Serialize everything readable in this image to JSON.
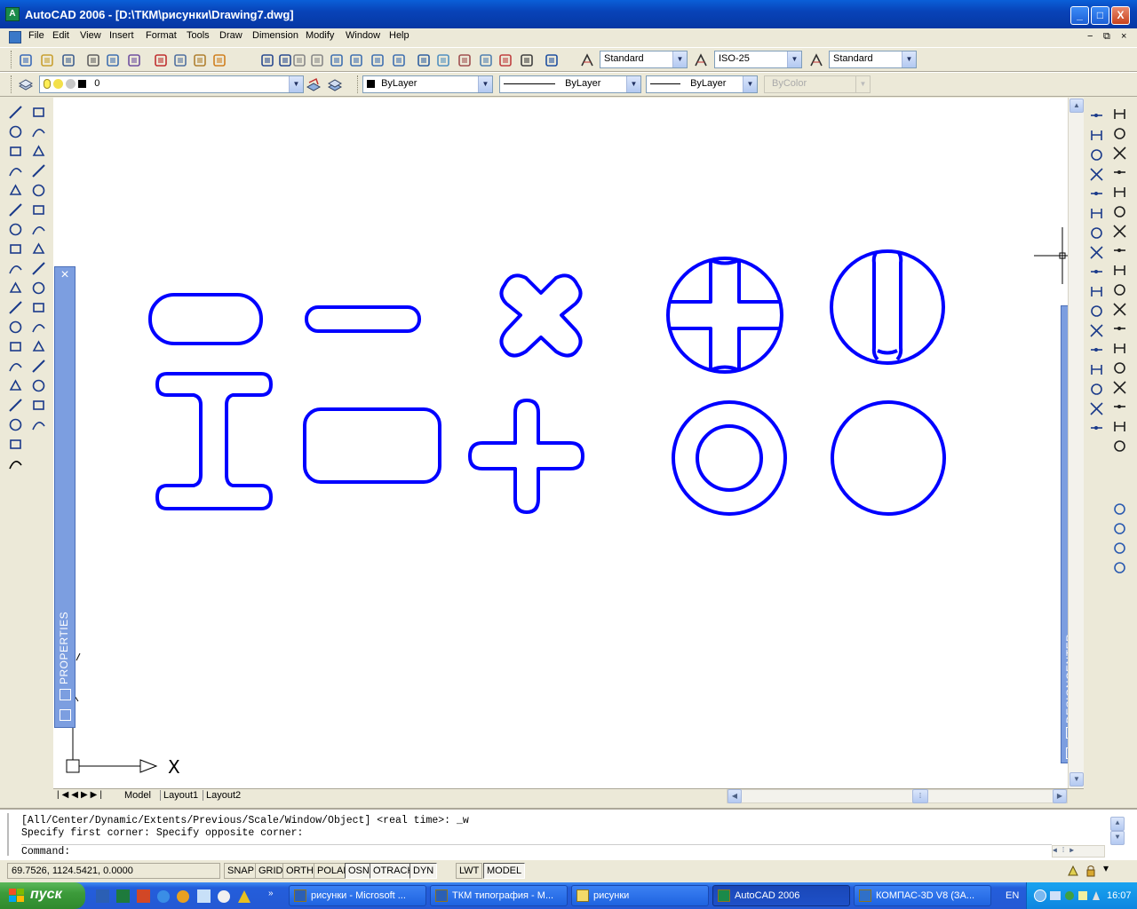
{
  "window": {
    "title": "AutoCAD 2006 - [D:\\ТКМ\\рисунки\\Drawing7.dwg]",
    "app_icon": "autocad-icon",
    "buttons": {
      "minimize": "_",
      "maximize": "□",
      "close": "X"
    }
  },
  "menu": {
    "items": [
      "File",
      "Edit",
      "View",
      "Insert",
      "Format",
      "Tools",
      "Draw",
      "Dimension",
      "Modify",
      "Window",
      "Help"
    ],
    "doc_controls": {
      "minimize": "−",
      "restore": "⧉",
      "close": "×"
    }
  },
  "toolbars": {
    "standard": {
      "text_style": "Standard",
      "dim_style": "ISO-25",
      "table_style": "Standard"
    },
    "layers": {
      "current_layer": "0",
      "color": "ByLayer",
      "linetype": "ByLayer",
      "lineweight": "ByLayer",
      "plot_style": "ByColor"
    }
  },
  "palettes": {
    "properties": {
      "label": "PROPERTIES",
      "close": "×"
    },
    "designcenter": {
      "label": "DESIGNCENTER",
      "close": "×"
    }
  },
  "canvas": {
    "ucs_x_label": "X",
    "stroke_color": "#0000ff"
  },
  "layout_tabs": [
    "Model",
    "Layout1",
    "Layout2"
  ],
  "command": {
    "lines": [
      "[All/Center/Dynamic/Extents/Previous/Scale/Window/Object] <real time>: _w",
      "Specify first corner: Specify opposite corner:"
    ],
    "prompt": "Command:"
  },
  "status": {
    "coordinates": "69.7526, 1124.5421, 0.0000",
    "toggles": [
      {
        "label": "SNAP",
        "on": false
      },
      {
        "label": "GRID",
        "on": false
      },
      {
        "label": "ORTHO",
        "on": false
      },
      {
        "label": "POLAR",
        "on": false
      },
      {
        "label": "OSNAP",
        "on": true
      },
      {
        "label": "OTRACK",
        "on": true
      },
      {
        "label": "DYN",
        "on": true
      },
      {
        "label": "LWT",
        "on": false
      },
      {
        "label": "MODEL",
        "on": true
      }
    ]
  },
  "taskbar": {
    "start": "пуск",
    "tasks": [
      {
        "label": "рисунки - Microsoft ...",
        "active": false
      },
      {
        "label": "ТКМ типография - М...",
        "active": false
      },
      {
        "label": "рисунки",
        "active": false
      },
      {
        "label": "AutoCAD 2006",
        "active": true
      },
      {
        "label": "КОМПАС-3D V8 (ЗА...",
        "active": false
      }
    ],
    "language": "EN",
    "clock": "16:07"
  }
}
